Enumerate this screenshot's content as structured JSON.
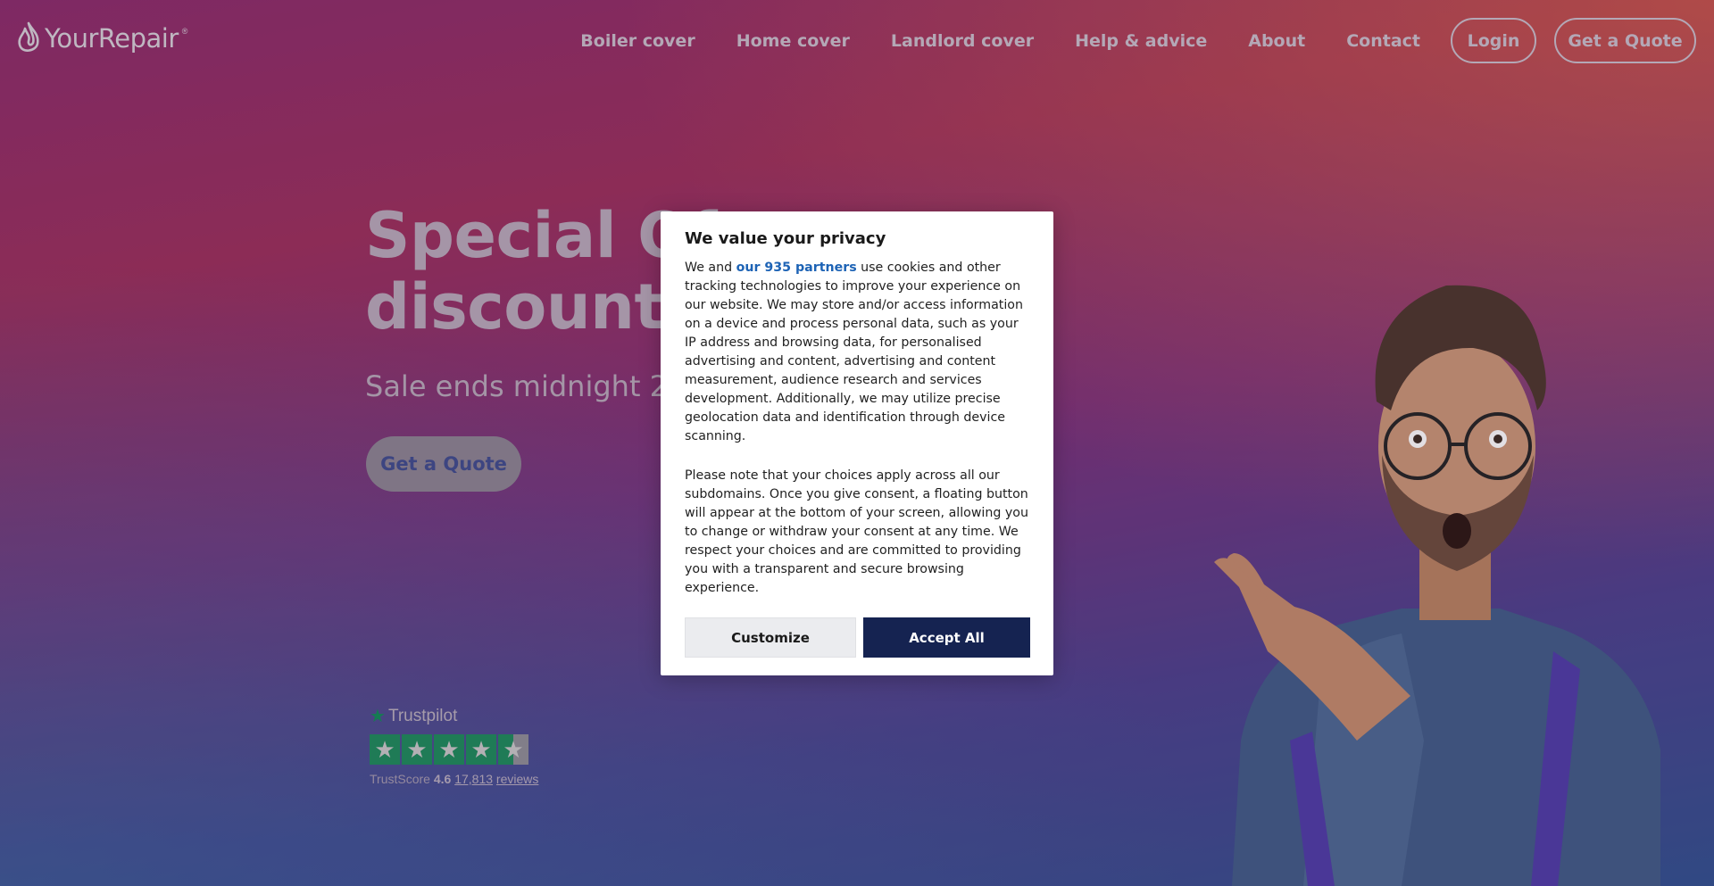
{
  "brand": {
    "name": "YourRepair",
    "mark": "®"
  },
  "nav": {
    "links": [
      "Boiler cover",
      "Home cover",
      "Landlord cover",
      "Help & advice",
      "About",
      "Contact"
    ],
    "login_label": "Login",
    "quote_label": "Get a Quote"
  },
  "hero": {
    "title_line1": "Special Of",
    "title_line2": "discount c",
    "subtitle": "Sale ends midnight 24",
    "cta_label": "Get a Quote"
  },
  "trustpilot": {
    "brand": "Trustpilot",
    "rating_stars": 4.5,
    "score_label": "TrustScore",
    "score_value": "4.6",
    "reviews_count": "17,813",
    "reviews_label": "reviews"
  },
  "consent": {
    "title": "We value your privacy",
    "intro_before_link": "We and ",
    "partners_link": "our 935 partners",
    "intro_after_link": " use cookies and other tracking technologies to improve your experience on our website. We may store and/or access information on a device and process personal data, such as your IP address and browsing data, for personalised advertising and content, advertising and content measurement, audience research and services development. Additionally, we may utilize precise geolocation data and identification through device scanning.",
    "paragraph2": "Please note that your choices apply across all our subdomains. Once you give consent, a floating button will appear at the bottom of your screen, allowing you to change or withdraw your consent at any time. We respect your choices and are committed to providing you with a transparent and secure browsing experience.",
    "customize_label": "Customize",
    "accept_label": "Accept All"
  },
  "colors": {
    "accent_dark": "#152351",
    "link": "#1d63b5",
    "trustpilot_green": "#1a8a5a"
  }
}
